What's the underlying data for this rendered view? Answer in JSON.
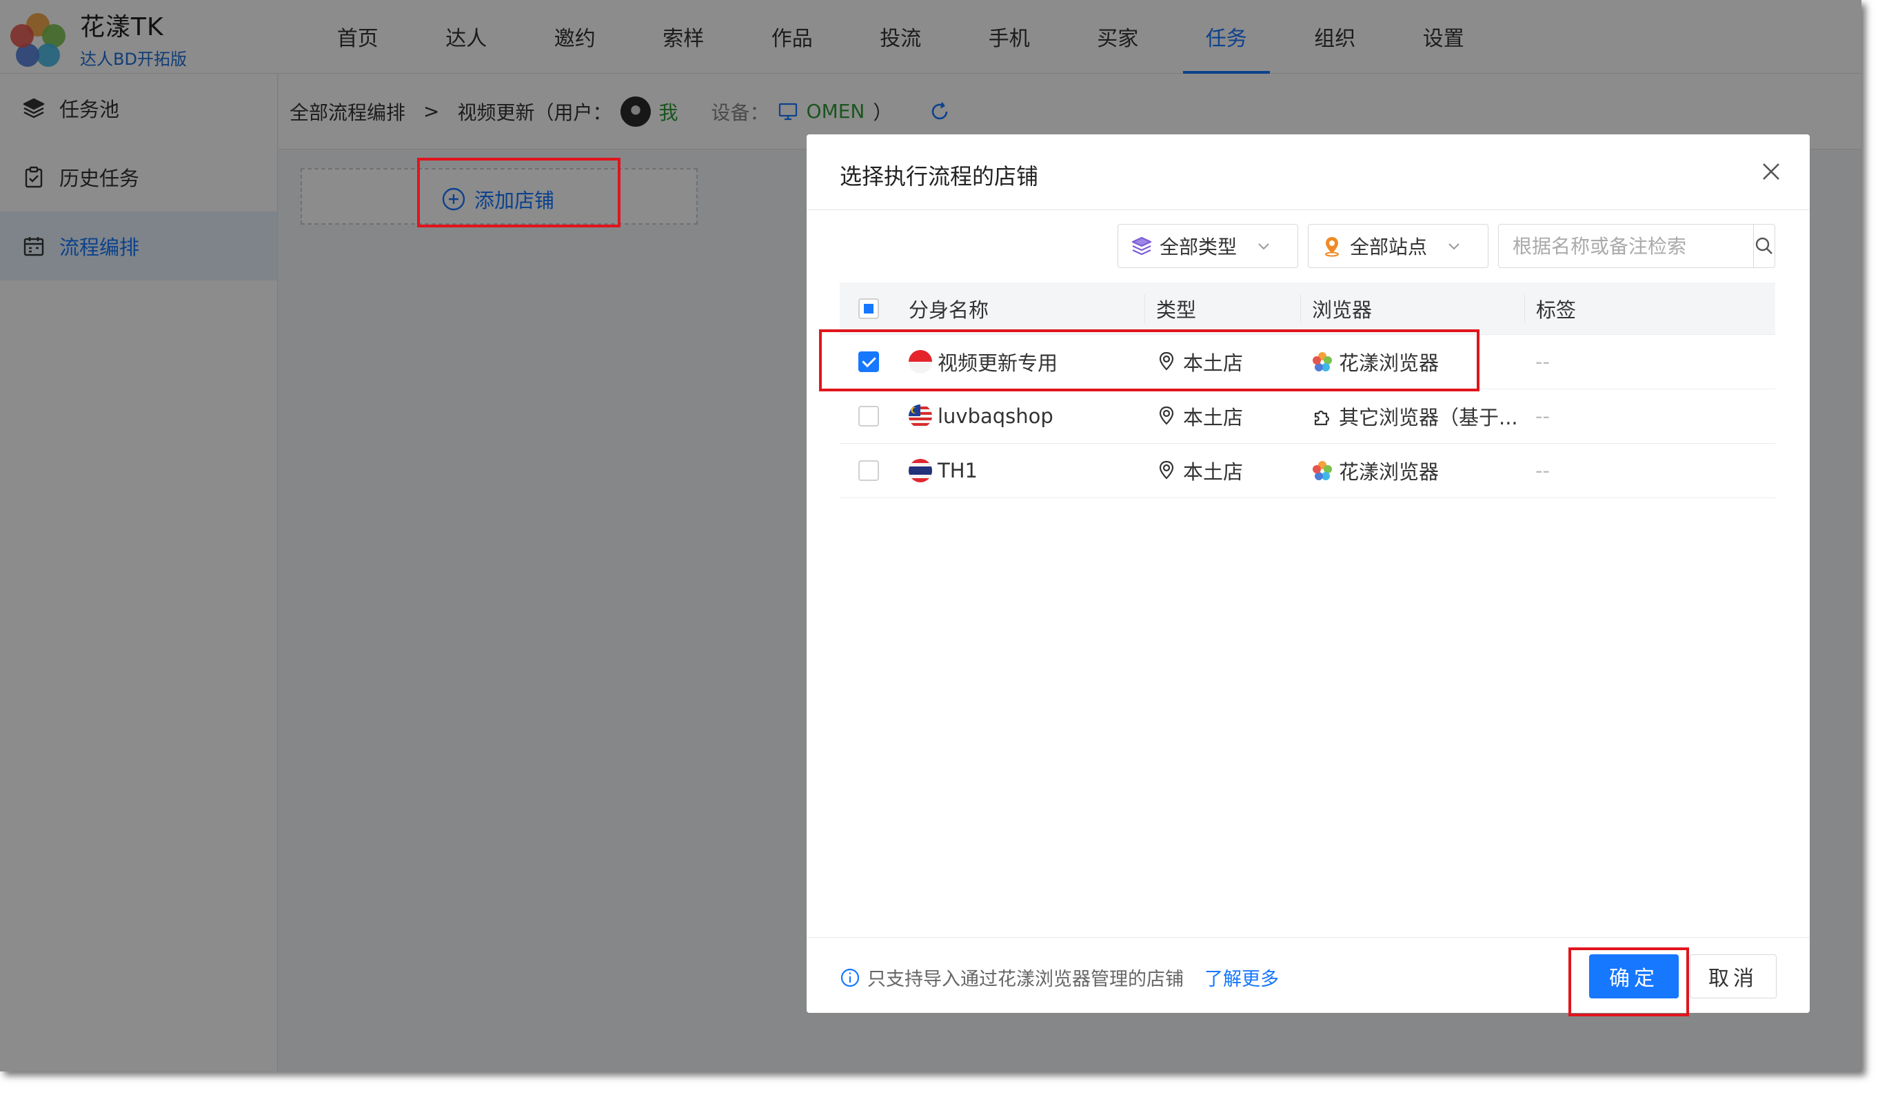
{
  "app": {
    "name": "花漾TK",
    "edition": "达人BD开拓版"
  },
  "nav": [
    {
      "label": "首页",
      "active": false
    },
    {
      "label": "达人",
      "active": false
    },
    {
      "label": "邀约",
      "active": false
    },
    {
      "label": "索样",
      "active": false
    },
    {
      "label": "作品",
      "active": false
    },
    {
      "label": "投流",
      "active": false
    },
    {
      "label": "手机",
      "active": false
    },
    {
      "label": "买家",
      "active": false
    },
    {
      "label": "任务",
      "active": true
    },
    {
      "label": "组织",
      "active": false
    },
    {
      "label": "设置",
      "active": false
    }
  ],
  "sidebar": {
    "items": [
      {
        "label": "任务池",
        "icon": "layers-icon",
        "active": false
      },
      {
        "label": "历史任务",
        "icon": "clipboard-icon",
        "active": false
      },
      {
        "label": "流程编排",
        "icon": "calendar-icon",
        "active": true
      }
    ]
  },
  "breadcrumb": {
    "root": "全部流程编排",
    "separator": ">",
    "current": "视频更新（用户：",
    "user": "我",
    "device_label": "设备：",
    "device": "OMEN",
    "close_paren": "）"
  },
  "main": {
    "add_store_label": "添加店铺"
  },
  "modal": {
    "title": "选择执行流程的店铺",
    "filters": {
      "type_label": "全部类型",
      "site_label": "全部站点",
      "search_placeholder": "根据名称或备注检索"
    },
    "table": {
      "columns": [
        "分身名称",
        "类型",
        "浏览器",
        "标签"
      ],
      "rows": [
        {
          "name": "视频更新专用",
          "flag": "indonesia-flag-icon",
          "type": "本土店",
          "browser": "花漾浏览器",
          "browser_icon": "huayang-flower-icon",
          "tag": "--",
          "checked": true
        },
        {
          "name": "luvbaqshop",
          "flag": "malaysia-flag-icon",
          "type": "本土店",
          "browser": "其它浏览器（基于...",
          "browser_icon": "puzzle-icon",
          "tag": "--",
          "checked": false
        },
        {
          "name": "TH1",
          "flag": "thailand-flag-icon",
          "type": "本土店",
          "browser": "花漾浏览器",
          "browser_icon": "huayang-flower-icon",
          "tag": "--",
          "checked": false
        }
      ]
    },
    "footer": {
      "note": "只支持导入通过花漾浏览器管理的店铺",
      "learn_more": "了解更多",
      "ok_label": "确定",
      "cancel_label": "取消"
    }
  },
  "colors": {
    "accent": "#1677ff",
    "user_green": "#2f9b37",
    "annotation_red": "#e1141c"
  }
}
